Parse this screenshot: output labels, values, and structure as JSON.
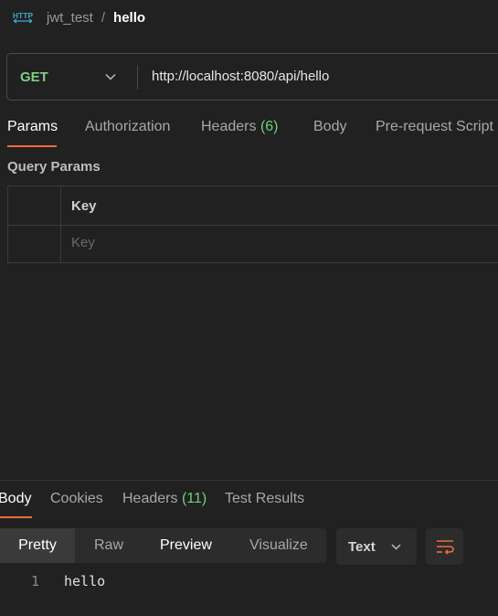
{
  "breadcrumb": {
    "icon": "http-icon",
    "parent": "jwt_test",
    "separator": "/",
    "current": "hello"
  },
  "request": {
    "method": "GET",
    "url": "http://localhost:8080/api/hello"
  },
  "request_tabs": {
    "params": "Params",
    "authorization": "Authorization",
    "headers": "Headers",
    "headers_count": "(6)",
    "body": "Body",
    "prerequest": "Pre-request Script"
  },
  "query_params": {
    "title": "Query Params",
    "key_header": "Key",
    "key_placeholder": "Key"
  },
  "response_tabs": {
    "body": "Body",
    "cookies": "Cookies",
    "headers": "Headers",
    "headers_count": "(11)",
    "test_results": "Test Results"
  },
  "response_view": {
    "pretty": "Pretty",
    "raw": "Raw",
    "preview": "Preview",
    "visualize": "Visualize",
    "format": "Text"
  },
  "response_body": {
    "line_number": "1",
    "line_text": "hello"
  },
  "colors": {
    "accent": "#f26b3a",
    "method": "#7ecf84",
    "count": "#6fcf7d",
    "http_icon": "#3fa9c9"
  }
}
